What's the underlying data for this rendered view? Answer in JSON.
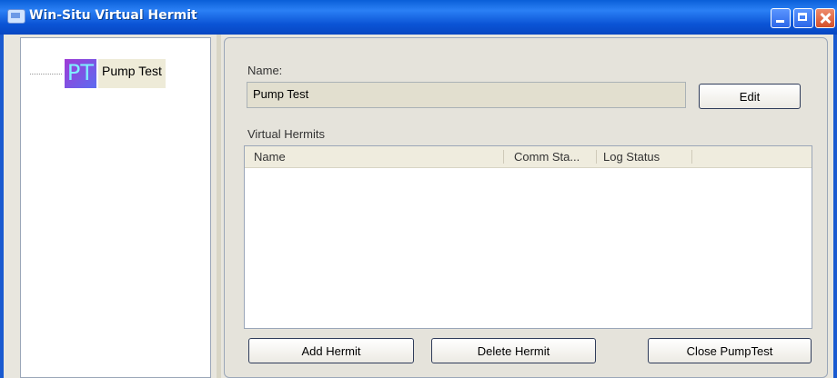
{
  "window": {
    "title": "Win-Situ Virtual Hermit"
  },
  "tree": {
    "node_icon_text": "PT",
    "node_label": "Pump Test"
  },
  "panel": {
    "name_label": "Name:",
    "name_value": "Pump Test",
    "edit_button": "Edit",
    "virtual_hermits_label": "Virtual Hermits",
    "columns": [
      "Name",
      "Comm Sta...",
      "Log Status"
    ],
    "rows": [],
    "buttons": {
      "add": "Add Hermit",
      "delete": "Delete Hermit",
      "close": "Close PumpTest"
    }
  },
  "icons": [
    "app-icon",
    "minimize-icon",
    "maximize-icon",
    "close-icon"
  ]
}
